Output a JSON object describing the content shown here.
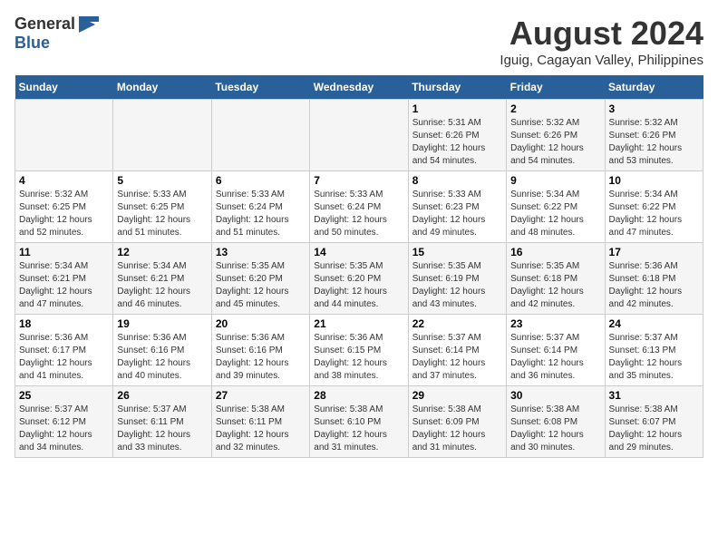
{
  "logo": {
    "general": "General",
    "blue": "Blue"
  },
  "title": "August 2024",
  "location": "Iguig, Cagayan Valley, Philippines",
  "days_header": [
    "Sunday",
    "Monday",
    "Tuesday",
    "Wednesday",
    "Thursday",
    "Friday",
    "Saturday"
  ],
  "weeks": [
    [
      {
        "day": "",
        "content": ""
      },
      {
        "day": "",
        "content": ""
      },
      {
        "day": "",
        "content": ""
      },
      {
        "day": "",
        "content": ""
      },
      {
        "day": "1",
        "content": "Sunrise: 5:31 AM\nSunset: 6:26 PM\nDaylight: 12 hours\nand 54 minutes."
      },
      {
        "day": "2",
        "content": "Sunrise: 5:32 AM\nSunset: 6:26 PM\nDaylight: 12 hours\nand 54 minutes."
      },
      {
        "day": "3",
        "content": "Sunrise: 5:32 AM\nSunset: 6:26 PM\nDaylight: 12 hours\nand 53 minutes."
      }
    ],
    [
      {
        "day": "4",
        "content": "Sunrise: 5:32 AM\nSunset: 6:25 PM\nDaylight: 12 hours\nand 52 minutes."
      },
      {
        "day": "5",
        "content": "Sunrise: 5:33 AM\nSunset: 6:25 PM\nDaylight: 12 hours\nand 51 minutes."
      },
      {
        "day": "6",
        "content": "Sunrise: 5:33 AM\nSunset: 6:24 PM\nDaylight: 12 hours\nand 51 minutes."
      },
      {
        "day": "7",
        "content": "Sunrise: 5:33 AM\nSunset: 6:24 PM\nDaylight: 12 hours\nand 50 minutes."
      },
      {
        "day": "8",
        "content": "Sunrise: 5:33 AM\nSunset: 6:23 PM\nDaylight: 12 hours\nand 49 minutes."
      },
      {
        "day": "9",
        "content": "Sunrise: 5:34 AM\nSunset: 6:22 PM\nDaylight: 12 hours\nand 48 minutes."
      },
      {
        "day": "10",
        "content": "Sunrise: 5:34 AM\nSunset: 6:22 PM\nDaylight: 12 hours\nand 47 minutes."
      }
    ],
    [
      {
        "day": "11",
        "content": "Sunrise: 5:34 AM\nSunset: 6:21 PM\nDaylight: 12 hours\nand 47 minutes."
      },
      {
        "day": "12",
        "content": "Sunrise: 5:34 AM\nSunset: 6:21 PM\nDaylight: 12 hours\nand 46 minutes."
      },
      {
        "day": "13",
        "content": "Sunrise: 5:35 AM\nSunset: 6:20 PM\nDaylight: 12 hours\nand 45 minutes."
      },
      {
        "day": "14",
        "content": "Sunrise: 5:35 AM\nSunset: 6:20 PM\nDaylight: 12 hours\nand 44 minutes."
      },
      {
        "day": "15",
        "content": "Sunrise: 5:35 AM\nSunset: 6:19 PM\nDaylight: 12 hours\nand 43 minutes."
      },
      {
        "day": "16",
        "content": "Sunrise: 5:35 AM\nSunset: 6:18 PM\nDaylight: 12 hours\nand 42 minutes."
      },
      {
        "day": "17",
        "content": "Sunrise: 5:36 AM\nSunset: 6:18 PM\nDaylight: 12 hours\nand 42 minutes."
      }
    ],
    [
      {
        "day": "18",
        "content": "Sunrise: 5:36 AM\nSunset: 6:17 PM\nDaylight: 12 hours\nand 41 minutes."
      },
      {
        "day": "19",
        "content": "Sunrise: 5:36 AM\nSunset: 6:16 PM\nDaylight: 12 hours\nand 40 minutes."
      },
      {
        "day": "20",
        "content": "Sunrise: 5:36 AM\nSunset: 6:16 PM\nDaylight: 12 hours\nand 39 minutes."
      },
      {
        "day": "21",
        "content": "Sunrise: 5:36 AM\nSunset: 6:15 PM\nDaylight: 12 hours\nand 38 minutes."
      },
      {
        "day": "22",
        "content": "Sunrise: 5:37 AM\nSunset: 6:14 PM\nDaylight: 12 hours\nand 37 minutes."
      },
      {
        "day": "23",
        "content": "Sunrise: 5:37 AM\nSunset: 6:14 PM\nDaylight: 12 hours\nand 36 minutes."
      },
      {
        "day": "24",
        "content": "Sunrise: 5:37 AM\nSunset: 6:13 PM\nDaylight: 12 hours\nand 35 minutes."
      }
    ],
    [
      {
        "day": "25",
        "content": "Sunrise: 5:37 AM\nSunset: 6:12 PM\nDaylight: 12 hours\nand 34 minutes."
      },
      {
        "day": "26",
        "content": "Sunrise: 5:37 AM\nSunset: 6:11 PM\nDaylight: 12 hours\nand 33 minutes."
      },
      {
        "day": "27",
        "content": "Sunrise: 5:38 AM\nSunset: 6:11 PM\nDaylight: 12 hours\nand 32 minutes."
      },
      {
        "day": "28",
        "content": "Sunrise: 5:38 AM\nSunset: 6:10 PM\nDaylight: 12 hours\nand 31 minutes."
      },
      {
        "day": "29",
        "content": "Sunrise: 5:38 AM\nSunset: 6:09 PM\nDaylight: 12 hours\nand 31 minutes."
      },
      {
        "day": "30",
        "content": "Sunrise: 5:38 AM\nSunset: 6:08 PM\nDaylight: 12 hours\nand 30 minutes."
      },
      {
        "day": "31",
        "content": "Sunrise: 5:38 AM\nSunset: 6:07 PM\nDaylight: 12 hours\nand 29 minutes."
      }
    ]
  ]
}
